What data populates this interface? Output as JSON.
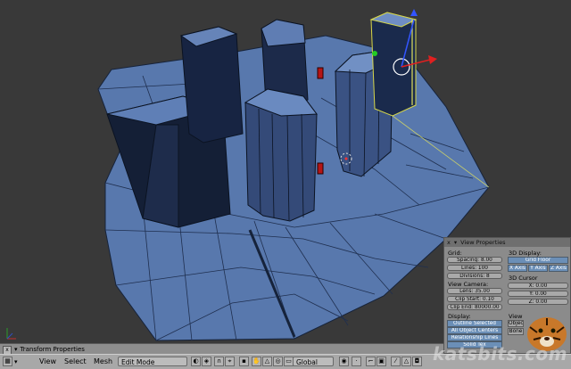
{
  "viewport": {
    "object_label": "(1) Plane",
    "colors": {
      "background": "#393939",
      "mesh_face": "#5a7ab0",
      "mesh_dark": "#1b2a48",
      "edge": "#0f1a2e"
    }
  },
  "transform_strip": {
    "close_glyph": "x",
    "label": "Transform Properties"
  },
  "header": {
    "view": "View",
    "select": "Select",
    "mesh": "Mesh",
    "mode": "Edit Mode",
    "orientation": "Global"
  },
  "view_properties": {
    "title": "View Properties",
    "grid_label": "Grid:",
    "spacing": "Spacing: 8.00",
    "lines": "Lines: 100",
    "divisions": "Divisions: 8",
    "view_camera_label": "View Camera:",
    "lens": "Lens: 35.00",
    "clip_start": "Clip Start: 0.10",
    "clip_end": "Clip End: 80000.00",
    "display_label": "Display:",
    "outline_selected": "Outline Selected",
    "all_object_centers": "All Object Centers",
    "relationship_lines": "Relationship Lines",
    "solid_tex": "Solid Tex",
    "display3d_label": "3D Display:",
    "grid_floor": "Grid Floor",
    "x_axis": "X Axis",
    "y_axis": "Y Axis",
    "z_axis": "Z Axis",
    "cursor_label": "3D Cursor",
    "cursor_x": "X: 0.00",
    "cursor_y": "Y: 0.00",
    "cursor_z": "Z: 0.00",
    "view_lock_label": "View",
    "object_field": "Object",
    "bone_field": "Bone"
  },
  "watermark": "katsbits.com"
}
